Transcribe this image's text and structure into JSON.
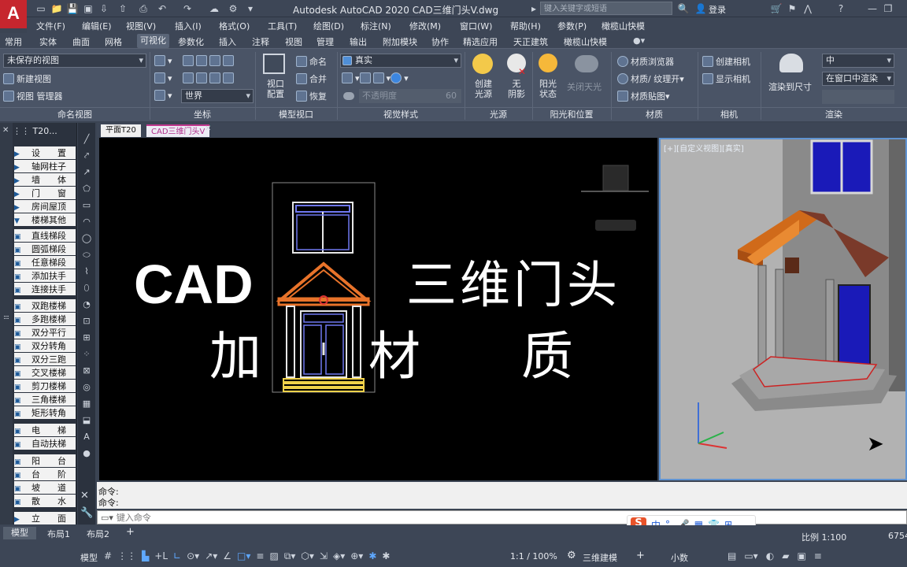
{
  "app": {
    "logo": "A",
    "title": "Autodesk AutoCAD 2020    CAD三维门头V.dwg",
    "search_placeholder": "键入关键字或短语",
    "login": "登录"
  },
  "menus": [
    "文件(F)",
    "编辑(E)",
    "视图(V)",
    "插入(I)",
    "格式(O)",
    "工具(T)",
    "绘图(D)",
    "标注(N)",
    "修改(M)",
    "窗口(W)",
    "帮助(H)",
    "参数(P)",
    "橄榄山快模"
  ],
  "ribbon_tabs": [
    "常用",
    "实体",
    "曲面",
    "网格",
    "可视化",
    "参数化",
    "插入",
    "注释",
    "视图",
    "管理",
    "输出",
    "附加模块",
    "协作",
    "精选应用",
    "天正建筑",
    "橄榄山快模"
  ],
  "active_tab": "可视化",
  "ribbon": {
    "named_views": {
      "dropdown": "未保存的视图",
      "new": "新建视图",
      "manager": "视图 管理器",
      "label": "命名视图"
    },
    "coords": {
      "world": "世界",
      "label": "坐标"
    },
    "model_viewports": {
      "config": "视口\n配置",
      "name": "命名",
      "join": "合并",
      "restore": "恢复",
      "label": "模型视口"
    },
    "visual_styles": {
      "style": "真实",
      "opacity": "不透明度",
      "opacity_value": "60",
      "label": "视觉样式"
    },
    "lights": {
      "create": "创建\n光源",
      "no_shadow": "无\n阴影",
      "sun": "阳光\n状态",
      "sky_off": "关闭天光",
      "label": "光源",
      "sun_label": "阳光和位置"
    },
    "materials": {
      "browser": "材质浏览器",
      "mapping": "材质/ 纹理开",
      "attach": "材质贴图",
      "label": "材质"
    },
    "camera": {
      "create": "创建相机",
      "show": "显示相机",
      "label": "相机"
    },
    "render": {
      "render_size": "渲染到尺寸",
      "quality": "中",
      "target": "在窗口中渲染",
      "label": "渲染"
    }
  },
  "palette": {
    "title": "T20...",
    "items": [
      {
        "label": "设　　置",
        "type": "cat"
      },
      {
        "label": "轴网柱子",
        "type": "cat"
      },
      {
        "label": "墙　　体",
        "type": "cat"
      },
      {
        "label": "门　　窗",
        "type": "cat"
      },
      {
        "label": "房间屋顶",
        "type": "cat"
      },
      {
        "label": "楼梯其他",
        "type": "open"
      },
      {
        "label": "直线梯段",
        "type": "tool"
      },
      {
        "label": "圆弧梯段",
        "type": "tool"
      },
      {
        "label": "任意梯段",
        "type": "tool"
      },
      {
        "label": "添加扶手",
        "type": "tool"
      },
      {
        "label": "连接扶手",
        "type": "tool"
      },
      {
        "label": "双跑楼梯",
        "type": "tool"
      },
      {
        "label": "多跑楼梯",
        "type": "tool"
      },
      {
        "label": "双分平行",
        "type": "tool"
      },
      {
        "label": "双分转角",
        "type": "tool"
      },
      {
        "label": "双分三跑",
        "type": "tool"
      },
      {
        "label": "交叉楼梯",
        "type": "tool"
      },
      {
        "label": "剪刀楼梯",
        "type": "tool"
      },
      {
        "label": "三角楼梯",
        "type": "tool"
      },
      {
        "label": "矩形转角",
        "type": "tool"
      },
      {
        "label": "电　　梯",
        "type": "tool"
      },
      {
        "label": "自动扶梯",
        "type": "tool"
      },
      {
        "label": "阳　　台",
        "type": "tool"
      },
      {
        "label": "台　　阶",
        "type": "tool"
      },
      {
        "label": "坡　　道",
        "type": "tool"
      },
      {
        "label": "散　　水",
        "type": "tool"
      },
      {
        "label": "立　　面",
        "type": "cat"
      }
    ]
  },
  "doc_tabs": [
    "平面T20",
    "CAD三维门头V"
  ],
  "canvas": {
    "line1_left": "CAD",
    "line1_right": "三维门头",
    "line2_left": "加",
    "line2_mid": "材",
    "line2_right": "质"
  },
  "viewport_label": "[+][自定义视图][真实]",
  "command": {
    "line1": "命令:",
    "line2": "命令:",
    "placeholder": "键入命令"
  },
  "layout_tabs": [
    "模型",
    "布局1",
    "布局2"
  ],
  "status": {
    "model": "模型",
    "scale_anno": "1:1 / 100%",
    "workspace": "三维建模",
    "units": "小数",
    "ratio": "比例 1:100",
    "coord": "6754"
  },
  "ime": [
    "中",
    "°,",
    "🎤",
    "▦",
    "👕",
    "⊞"
  ]
}
